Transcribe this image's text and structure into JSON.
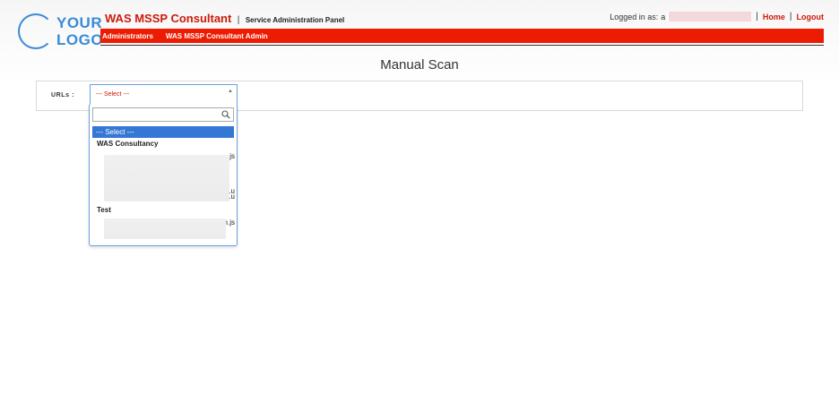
{
  "logo": {
    "line1": "YOUR",
    "line2": "LOGO"
  },
  "header": {
    "app_name": "WAS MSSP Consultant",
    "separator": "|",
    "app_subtitle": "Service Administration Panel",
    "logged_in_label": "Logged in as:",
    "logged_in_partial": "a",
    "home_link": "Home",
    "logout_link": "Logout",
    "link_separator": "|"
  },
  "nav": {
    "items": [
      {
        "label": "Administrators"
      },
      {
        "label": "WAS MSSP Consultant Admin"
      }
    ]
  },
  "main": {
    "page_title": "Manual Scan",
    "urls_label": "URLs :",
    "select_value": "--- Select ---",
    "dropdown": {
      "selected_option": "--- Select ---",
      "groups": [
        {
          "label": "WAS Consultancy",
          "item_suffixes": [
            ".js",
            ".u",
            ".u"
          ]
        },
        {
          "label": "Test",
          "item_suffixes": [
            "n.js"
          ]
        }
      ]
    }
  },
  "colors": {
    "brand_red": "#cc1b0b",
    "nav_red": "#ec1c03",
    "logo_blue": "#3a8bd8",
    "selection_blue": "#3577d4"
  }
}
